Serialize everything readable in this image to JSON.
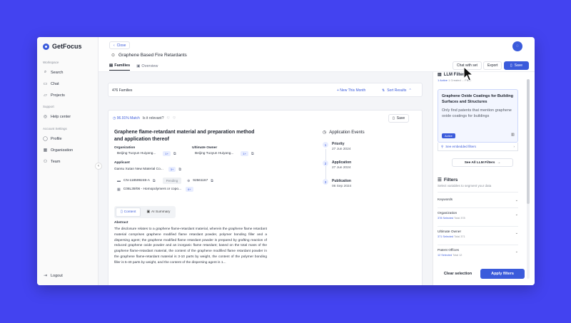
{
  "app": {
    "brand": "GetFocus"
  },
  "sidebar": {
    "sections": {
      "workspace": "Workspace",
      "support": "Support",
      "account": "Account Settings"
    },
    "items": [
      {
        "label": "Search",
        "icon": "search-icon"
      },
      {
        "label": "Chat",
        "icon": "chat-icon"
      },
      {
        "label": "Projects",
        "icon": "folder-icon"
      },
      {
        "label": "Help center",
        "icon": "help-icon"
      },
      {
        "label": "Profile",
        "icon": "user-icon"
      },
      {
        "label": "Organization",
        "icon": "building-icon"
      },
      {
        "label": "Team",
        "icon": "team-icon"
      }
    ],
    "logout": "Logout"
  },
  "header": {
    "close_label": "Close",
    "title": "Graphene Based Fire Retardants",
    "tabs": [
      {
        "label": "Families",
        "active": true
      },
      {
        "label": "Overview",
        "active": false
      }
    ],
    "chat_with_set": "Chat with set",
    "export": "Export",
    "save": "Save"
  },
  "families_bar": {
    "count": "476 Families",
    "new_this_month": "+ New This Month",
    "sort": "Sort Results"
  },
  "card": {
    "match": "96.91% Match",
    "relevant_q": "Is it relevant?",
    "save": "Save",
    "title": "Graphene flame-retardant material and preparation method and application thereof",
    "organization_label": "Organization",
    "organization_value": "Beijing Tuoyun Huiyang...",
    "organization_chip": "1+",
    "owner_label": "Ultimate Owner",
    "owner_value": "Beijing Tuoyun Huiyang...",
    "owner_chip": "1+",
    "applicant_label": "Applicant",
    "applicant_value": "Gansu Xutan New Material Co...",
    "applicant_chip": "3+",
    "patent_number": "CN-118599248-A",
    "status": "Pending",
    "family_id": "92561167",
    "cpc": "C08L39/06 - Homopolymers or copo...",
    "cpc_chip": "6+",
    "content_tabs": [
      "Content",
      "AI Summary"
    ],
    "abstract_label": "Abstract",
    "abstract_text": "The disclosure relates to a graphene flame-retardant material, wherein the graphene flame retardant material comprises graphene modified flame retardant powder, polymer bonding filler and a dispersing agent; the graphene modified flame retardant powder is prepared by grafting reaction of reduced graphene oxide powder and an inorganic flame retardant; based on the total mass of the graphene flame-retardant material, the content of the graphene modified flame retardant powder in the graphene flame-retardant material is 3-10 parts by weight, the content of the polymer bonding filler is 5-40 parts by weight, and the content of the dispersing agent is 1...",
    "events_title": "Application Events",
    "events": [
      {
        "num": "1",
        "name": "Priority",
        "date": "27 Jun 2024"
      },
      {
        "num": "2",
        "name": "Application",
        "date": "27 Jun 2024"
      },
      {
        "num": "3",
        "name": "Publication",
        "date": "06 Sep 2024"
      }
    ]
  },
  "right_panel": {
    "llm_title": "LLM Filters",
    "llm_active": "1 Active",
    "llm_sub_rest": "1 Created ... Filter",
    "llm_card_title": "Graphene Oxide Coatings for Building Surfaces and Structures",
    "llm_card_desc": "Only find patents that mention graphene oxide coatings for buildings",
    "active_badge": "Active",
    "embedded": "See embedded filters",
    "see_all": "See All LLM Filters",
    "filters_title": "Filters",
    "filters_sub": "Select variables to segment your data",
    "filter_rows": [
      {
        "label": "Keywords",
        "selected": "",
        "total": ""
      },
      {
        "label": "Organization",
        "selected": "378 Selected",
        "total": "Total 378"
      },
      {
        "label": "Ultimate Owner",
        "selected": "371 Selected",
        "total": "Total 371"
      },
      {
        "label": "Patent Offices",
        "selected": "12 Selected",
        "total": "Total 12"
      }
    ],
    "clear": "Clear selection",
    "apply": "Apply filters"
  },
  "colors": {
    "background": "#4343f0",
    "accent": "#3b5bdb"
  }
}
